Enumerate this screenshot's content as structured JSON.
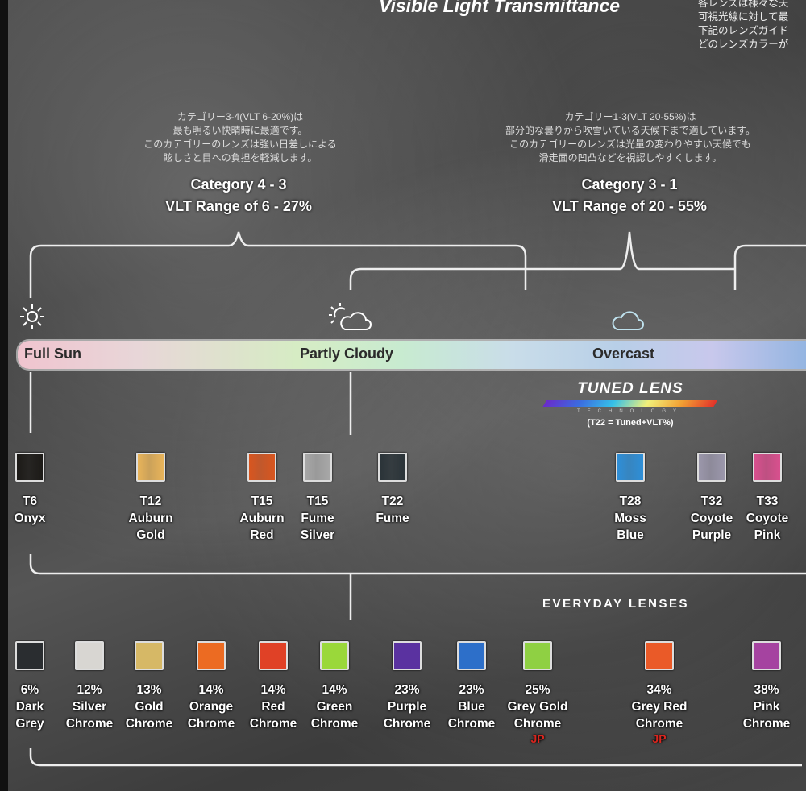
{
  "header": {
    "title": "Visible Light Transmittance",
    "jp_intro": [
      "各レンズは様々な天",
      "可視光線に対して最",
      "下記のレンズガイド",
      "どのレンズカラーが"
    ]
  },
  "categories": [
    {
      "jp": [
        "カテゴリー3-4(VLT 6-20%)は",
        "最も明るい快晴時に最適です。",
        "このカテゴリーのレンズは強い日差しによる",
        "眩しさと目への負担を軽減します。"
      ],
      "title": "Category 4 - 3",
      "range": "VLT Range of 6 - 27%"
    },
    {
      "jp": [
        "カテゴリー1-3(VLT 20-55%)は",
        "部分的な曇りから吹雪いている天候下まで適しています。",
        "このカテゴリーのレンズは光量の変わりやすい天候でも",
        "滑走面の凹凸などを視認しやすくします。"
      ],
      "title": "Category 3 - 1",
      "range": "VLT Range of 20 - 55%"
    }
  ],
  "conditions": [
    {
      "label": "Full Sun",
      "icon": "sun-icon"
    },
    {
      "label": "Partly Cloudy",
      "icon": "partly-cloudy-icon"
    },
    {
      "label": "Overcast",
      "icon": "cloud-icon"
    }
  ],
  "tuned_lens": {
    "name": "TUNED LENS",
    "tech": "TECHNOLOGY",
    "note": "(T22 = Tuned+VLT%)"
  },
  "tuned_lenses": [
    {
      "code": "T6",
      "name": [
        "Onyx"
      ],
      "color": "#1c1a17"
    },
    {
      "code": "T12",
      "name": [
        "Auburn",
        "Gold"
      ],
      "color": "#e8b45a"
    },
    {
      "code": "T15",
      "name": [
        "Auburn",
        "Red"
      ],
      "color": "#d9561f"
    },
    {
      "code": "T15",
      "name": [
        "Fume",
        "Silver"
      ],
      "color": "#a8a8a8"
    },
    {
      "code": "T22",
      "name": [
        "Fume"
      ],
      "color": "#2a3338"
    },
    {
      "code": "T28",
      "name": [
        "Moss",
        "Blue"
      ],
      "color": "#2e8fd8"
    },
    {
      "code": "T32",
      "name": [
        "Coyote",
        "Purple"
      ],
      "color": "#9b97ab"
    },
    {
      "code": "T33",
      "name": [
        "Coyote",
        "Pink"
      ],
      "color": "#d9508e"
    }
  ],
  "everyday_title": "EVERYDAY LENSES",
  "everyday_lenses": [
    {
      "vlt": "6%",
      "name": [
        "Dark",
        "Grey"
      ],
      "color": "#2a2d30",
      "jp": ""
    },
    {
      "vlt": "12%",
      "name": [
        "Silver",
        "Chrome"
      ],
      "color": "#d8d6d2",
      "jp": ""
    },
    {
      "vlt": "13%",
      "name": [
        "Gold",
        "Chrome"
      ],
      "color": "#d6b866",
      "jp": ""
    },
    {
      "vlt": "14%",
      "name": [
        "Orange",
        "Chrome"
      ],
      "color": "#ec6b22",
      "jp": ""
    },
    {
      "vlt": "14%",
      "name": [
        "Red",
        "Chrome"
      ],
      "color": "#e04126",
      "jp": ""
    },
    {
      "vlt": "14%",
      "name": [
        "Green",
        "Chrome"
      ],
      "color": "#9ad83a",
      "jp": ""
    },
    {
      "vlt": "23%",
      "name": [
        "Purple",
        "Chrome"
      ],
      "color": "#5a32a0",
      "jp": ""
    },
    {
      "vlt": "23%",
      "name": [
        "Blue",
        "Chrome"
      ],
      "color": "#2d6fc9",
      "jp": ""
    },
    {
      "vlt": "25%",
      "name": [
        "Grey Gold",
        "Chrome"
      ],
      "color": "#8fd043",
      "jp": "JP"
    },
    {
      "vlt": "34%",
      "name": [
        "Grey Red",
        "Chrome"
      ],
      "color": "#ea5a28",
      "jp": "JP"
    },
    {
      "vlt": "38%",
      "name": [
        "Pink",
        "Chrome"
      ],
      "color": "#a543a0",
      "jp": ""
    }
  ]
}
